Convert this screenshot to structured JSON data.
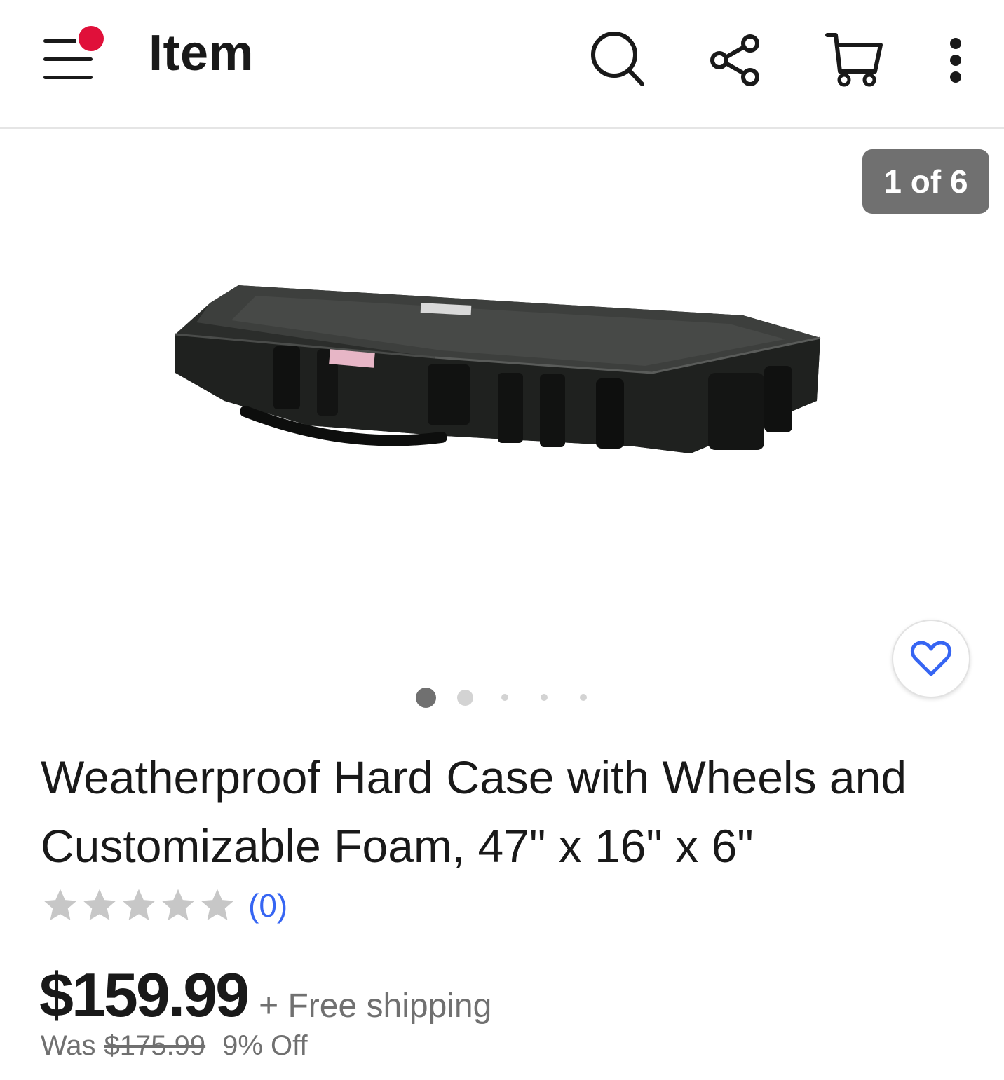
{
  "header": {
    "title": "Item",
    "menu_icon": "hamburger-menu-icon",
    "notification_color": "#e0103a",
    "actions": [
      {
        "name": "search",
        "icon": "search-icon"
      },
      {
        "name": "share",
        "icon": "share-icon"
      },
      {
        "name": "cart",
        "icon": "cart-icon"
      },
      {
        "name": "more",
        "icon": "more-vertical-icon"
      }
    ]
  },
  "gallery": {
    "counter": "1 of 6",
    "current_index": 1,
    "total_images": 6,
    "watch_icon": "heart-icon",
    "accent_color": "#3665f3",
    "dots_visible": 5,
    "active_dot": 0
  },
  "item": {
    "title": "Weatherproof Hard Case with Wheels and Customizable Foam, 47\" x 16\" x 6\"",
    "rating_stars": 0,
    "max_stars": 5,
    "review_count": "(0)",
    "price": "$159.99",
    "shipping": "+ Free shipping",
    "was_label": "Was",
    "was_price": "$175.99",
    "discount": "9% Off"
  }
}
